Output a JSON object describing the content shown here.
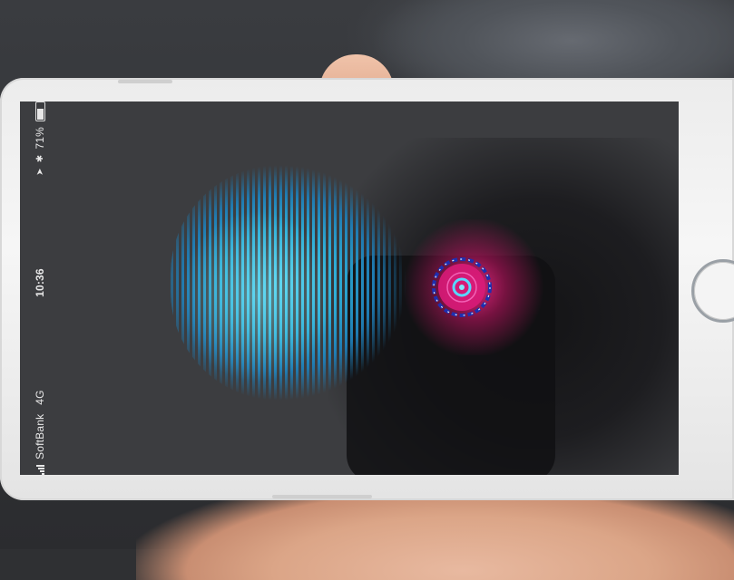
{
  "status_bar": {
    "carrier": "SoftBank",
    "network": "4G",
    "time": "10:36",
    "location_glyph": "➤",
    "bluetooth_glyph": "✱",
    "battery_percent": "71%",
    "battery_level": 0.71
  },
  "icons": {
    "signal": "cellular-signal-icon",
    "location": "location-arrow-icon",
    "bluetooth": "bluetooth-icon",
    "battery": "battery-icon"
  },
  "colors": {
    "hologram": "#3ec2ec",
    "target_ring": "#1e2fb0",
    "target_glow": "#ff2a8a"
  }
}
